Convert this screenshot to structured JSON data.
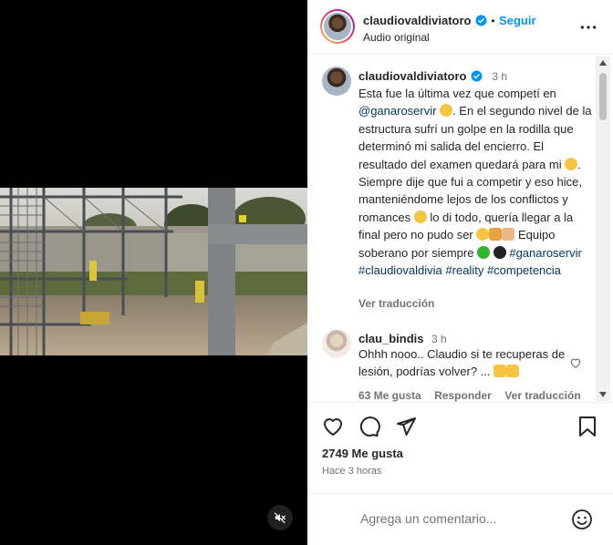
{
  "post": {
    "username": "claudiovaldiviatoro",
    "follow_label": "Seguir",
    "audio_label": "Audio original",
    "separator": "•"
  },
  "caption": {
    "username": "claudiovaldiviatoro",
    "time": "3 h",
    "line1": "Esta fue la última vez que competí en",
    "mention": "@ganaroservir",
    "line2": ". En el segundo nivel de la estructura sufrí un golpe en la rodilla que determinó mi salida del encierro. El resultado del examen quedará para mi",
    "line3": ". Siempre dije que fui a competir y eso hice, manteniéndome lejos de los conflictos y romances",
    "line4": "lo di todo, quería llegar a la final pero no pudo ser",
    "line5": "Equipo soberano por siempre",
    "hashtags": [
      "#ganaroservir",
      "#claudiovaldivia",
      "#reality",
      "#competencia"
    ],
    "see_translation": "Ver traducción"
  },
  "comment": {
    "username": "clau_bindis",
    "time": "3 h",
    "text": "Ohhh nooo.. Claudio si te recuperas de lesión, podrías volver? ...",
    "likes": "63 Me gusta",
    "reply": "Responder",
    "see_translation": "Ver traducción"
  },
  "stats": {
    "likes": "2749 Me gusta",
    "time_ago": "Hace 3 horas"
  },
  "add_comment": {
    "placeholder": "Agrega un comentario..."
  },
  "colors": {
    "accent": "#0095f6",
    "verified": "#0095f6",
    "link": "#00376b",
    "emoji_green": "#2fb52f",
    "emoji_black": "#222222"
  },
  "icons": [
    "mute-icon",
    "more-icon",
    "heart-icon",
    "comment-icon",
    "share-icon",
    "save-icon",
    "emoji-icon",
    "verified-icon"
  ]
}
